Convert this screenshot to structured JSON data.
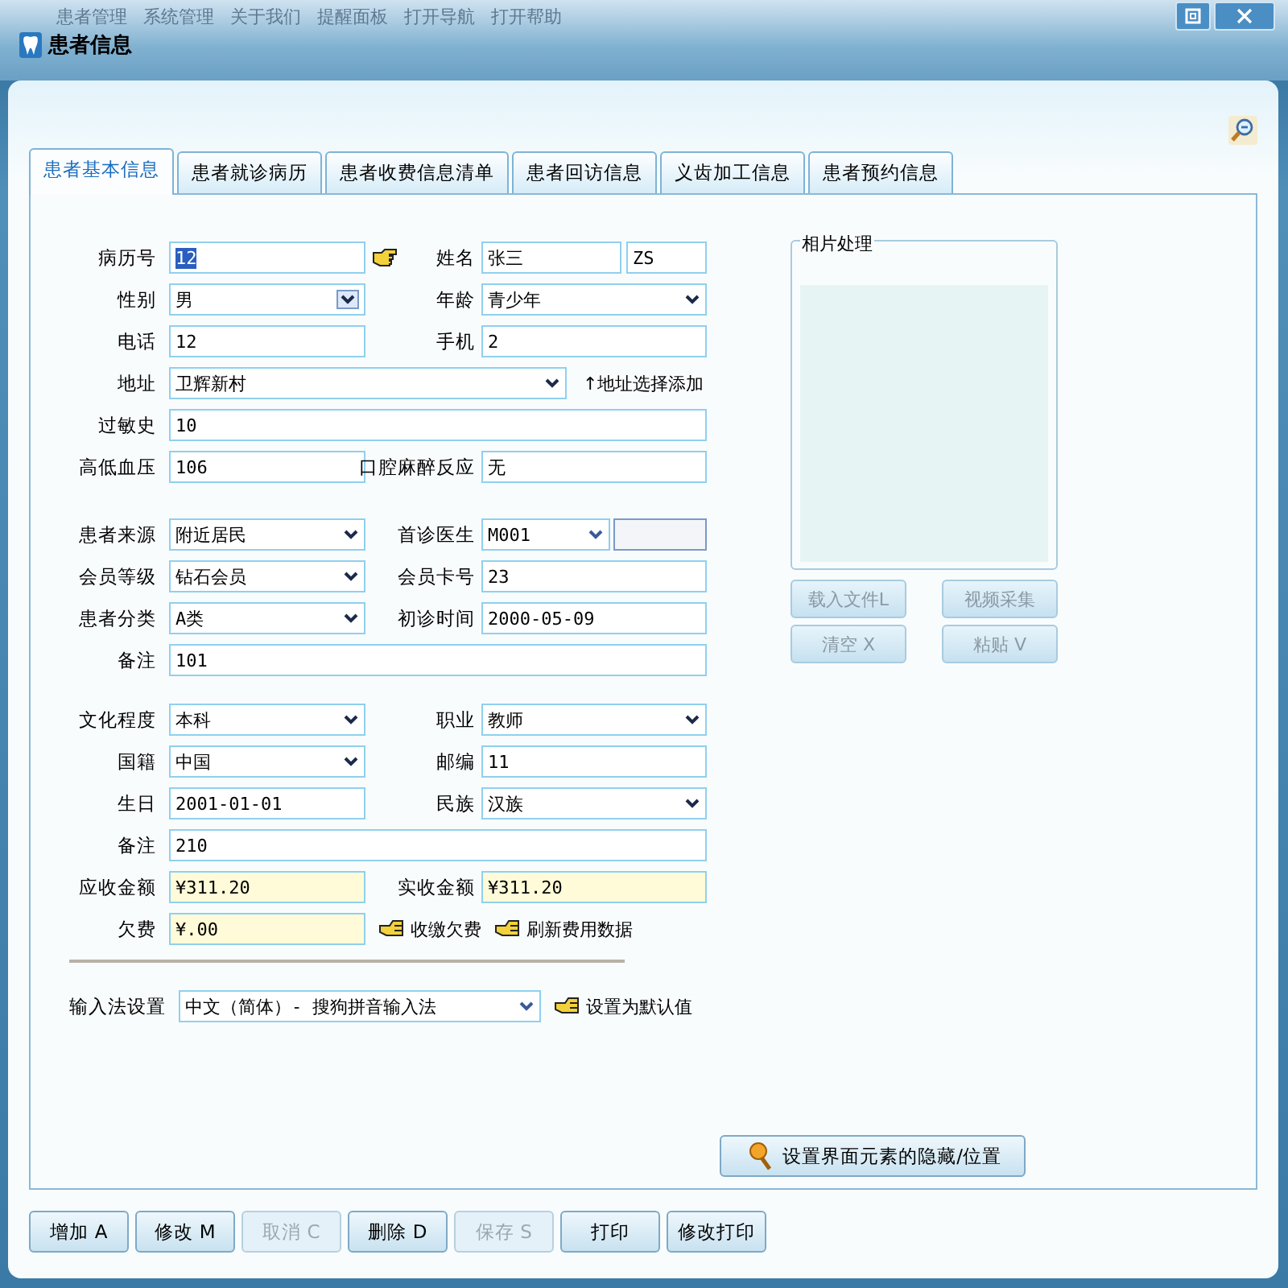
{
  "menu": [
    "患者管理",
    "系统管理",
    "关于我们",
    "提醒面板",
    "打开导航",
    "打开帮助"
  ],
  "window": {
    "title": "患者信息"
  },
  "tabs": [
    {
      "label": "患者基本信息",
      "selected": true
    },
    {
      "label": "患者就诊病历",
      "selected": false
    },
    {
      "label": "患者收费信息清单",
      "selected": false
    },
    {
      "label": "患者回访信息",
      "selected": false
    },
    {
      "label": "义齿加工信息",
      "selected": false
    },
    {
      "label": "患者预约信息",
      "selected": false
    }
  ],
  "sections": [
    {
      "rows": [
        {
          "fields": [
            {
              "label": "病历号",
              "value": "12",
              "kind": "lookup"
            },
            {
              "label": "姓名",
              "value": "张三",
              "extra": "ZS",
              "kind": "pair"
            }
          ]
        },
        {
          "fields": [
            {
              "label": "性别",
              "value": "男",
              "kind": "select"
            },
            {
              "label": "年龄",
              "value": "青少年",
              "kind": "select"
            }
          ]
        },
        {
          "fields": [
            {
              "label": "电话",
              "value": "12",
              "kind": "text"
            },
            {
              "label": "手机",
              "value": "2",
              "kind": "text"
            }
          ]
        },
        {
          "fields": [
            {
              "label": "地址",
              "value": "卫辉新村",
              "kind": "select"
            }
          ],
          "actions": [
            {
              "label": "↑地址选择添加",
              "kind": "link"
            }
          ]
        },
        {
          "fields": [
            {
              "label": "过敏史",
              "value": "10",
              "kind": "text"
            }
          ]
        },
        {
          "fields": [
            {
              "label": "高低血压",
              "value": "106",
              "kind": "text"
            },
            {
              "label": "口腔麻醉反应",
              "value": "无",
              "kind": "text"
            }
          ]
        }
      ]
    },
    {
      "rows": [
        {
          "fields": [
            {
              "label": "患者来源",
              "value": "附近居民",
              "kind": "select"
            },
            {
              "label": "首诊医生",
              "value": "M001",
              "kind": "select-pair"
            }
          ]
        },
        {
          "fields": [
            {
              "label": "会员等级",
              "value": "钻石会员",
              "kind": "select"
            },
            {
              "label": "会员卡号",
              "value": "23",
              "kind": "text"
            }
          ]
        },
        {
          "fields": [
            {
              "label": "患者分类",
              "value": "A类",
              "kind": "select"
            },
            {
              "label": "初诊时间",
              "value": "2000-05-09",
              "kind": "text"
            }
          ]
        },
        {
          "fields": [
            {
              "label": "备注",
              "value": "101",
              "kind": "text"
            }
          ]
        }
      ]
    },
    {
      "rows": [
        {
          "fields": [
            {
              "label": "文化程度",
              "value": "本科",
              "kind": "select"
            },
            {
              "label": "职业",
              "value": "教师",
              "kind": "select"
            }
          ]
        },
        {
          "fields": [
            {
              "label": "国籍",
              "value": "中国",
              "kind": "select"
            },
            {
              "label": "邮编",
              "value": "11",
              "kind": "text"
            }
          ]
        },
        {
          "fields": [
            {
              "label": "生日",
              "value": "2001-01-01",
              "kind": "text"
            },
            {
              "label": "民族",
              "value": "汉族",
              "kind": "select"
            }
          ]
        },
        {
          "fields": [
            {
              "label": "备注",
              "value": "210",
              "kind": "text"
            }
          ]
        },
        {
          "fields": [
            {
              "label": "应收金额",
              "value": "¥311.20",
              "kind": "money"
            },
            {
              "label": "实收金额",
              "value": "¥311.20",
              "kind": "money"
            }
          ]
        },
        {
          "fields": [
            {
              "label": "欠费",
              "value": "¥.00",
              "kind": "money"
            }
          ],
          "actions": [
            {
              "label": "收缴欠费",
              "kind": "hand"
            },
            {
              "label": "刷新费用数据",
              "kind": "hand"
            }
          ]
        }
      ]
    }
  ],
  "ime": {
    "label": "输入法设置",
    "value": "中文（简体）- 搜狗拼音输入法",
    "action": "设置为默认值"
  },
  "photo": {
    "title": "相片处理",
    "buttons": [
      {
        "label": "载入文件L",
        "disabled": true
      },
      {
        "label": "视频采集",
        "disabled": true
      },
      {
        "label": "清空 X",
        "disabled": true
      },
      {
        "label": "粘贴 V",
        "disabled": true
      }
    ]
  },
  "layout_button": "设置界面元素的隐藏/位置",
  "toolbar": [
    {
      "label": "增加 A",
      "disabled": false
    },
    {
      "label": "修改 M",
      "disabled": false
    },
    {
      "label": "取消 C",
      "disabled": true
    },
    {
      "label": "删除 D",
      "disabled": false
    },
    {
      "label": "保存 S",
      "disabled": true
    },
    {
      "label": "打印",
      "disabled": false
    },
    {
      "label": "修改打印",
      "disabled": false
    }
  ]
}
